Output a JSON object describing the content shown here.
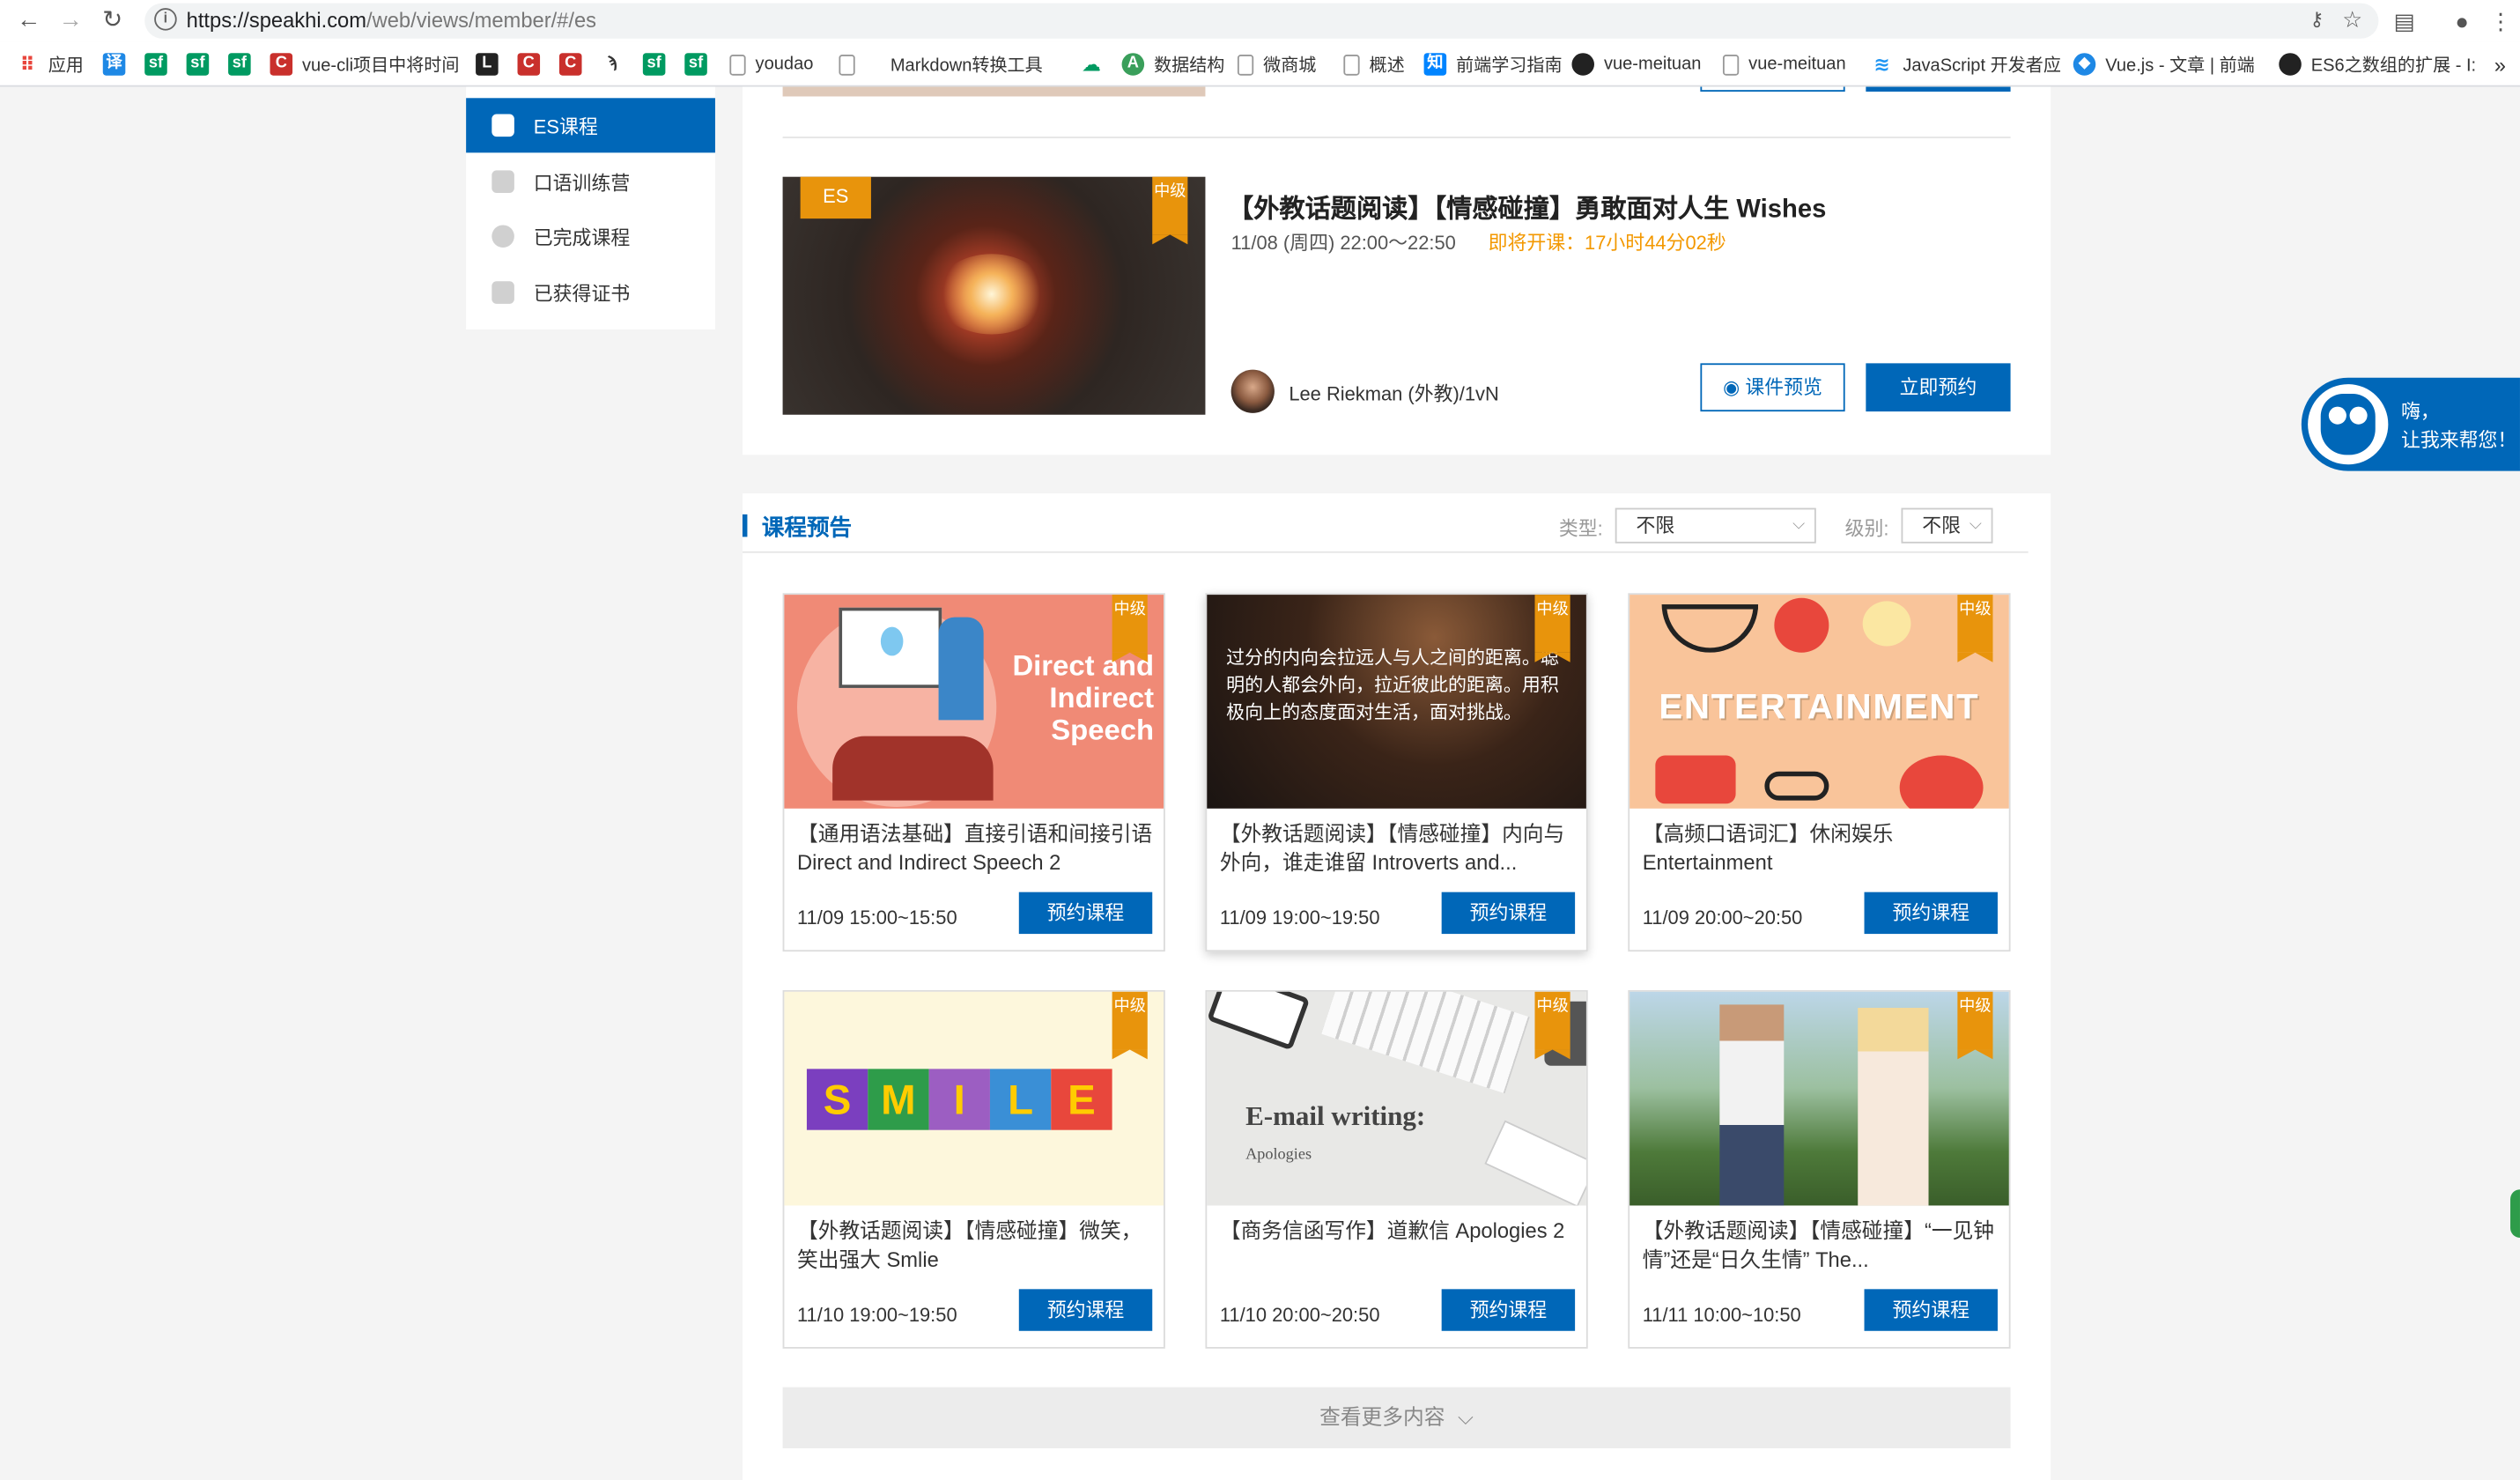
{
  "browser": {
    "url_host": "https://speakhi.com",
    "url_path": "/web/views/member/#/es",
    "bookmarks": [
      "应用",
      "vue-cli项目中将时间",
      "youdao",
      "Markdown转换工具",
      "数据结构",
      "微商城",
      "概述",
      "前端学习指南",
      "vue-meituan",
      "vue-meituan",
      "JavaScript 开发者应",
      "Vue.js - 文章 | 前端",
      "ES6之数组的扩展 - I:"
    ],
    "bookmark_icons": [
      "译",
      "sf",
      "sf",
      "sf",
      "C",
      "C",
      "C",
      "sf",
      "sf",
      "知"
    ]
  },
  "sidebar": {
    "items": [
      {
        "label": "ES课程",
        "active": true
      },
      {
        "label": "口语训练营",
        "active": false
      },
      {
        "label": "已完成课程",
        "active": false
      },
      {
        "label": "已获得证书",
        "active": false
      }
    ]
  },
  "featured": {
    "badge": "ES",
    "level": "中级",
    "title": "【外教话题阅读】【情感碰撞】勇敢面对人生 Wishes",
    "time": "11/08 (周四) 22:00～22:50",
    "countdown": "即将开课：17小时44分02秒",
    "teacher": "Lee Riekman (外教)/1vN",
    "preview_label": "课件预览",
    "book_label": "立即预约"
  },
  "preview_section": {
    "title": "课程预告",
    "type_label": "类型:",
    "type_value": "不限",
    "level_label": "级别:",
    "level_value": "不限",
    "more_label": "查看更多内容",
    "cards": [
      {
        "title": "【通用语法基础】直接引语和间接引语 Direct and Indirect Speech 2",
        "time": "11/09 15:00~15:50",
        "button": "预约课程",
        "level": "中级",
        "image_text": "Direct and Indirect Speech"
      },
      {
        "title": "【外教话题阅读】【情感碰撞】内向与外向，谁走谁留 Introverts and...",
        "time": "11/09 19:00~19:50",
        "button": "预约课程",
        "level": "中级",
        "image_text": "过分的内向会拉远人与人之间的距离。聪明的人都会外向，拉近彼此的距离。用积极向上的态度面对生活，面对挑战。"
      },
      {
        "title": "【高频口语词汇】休闲娱乐 Entertainment",
        "time": "11/09 20:00~20:50",
        "button": "预约课程",
        "level": "中级",
        "image_text": "ENTERTAINMENT"
      },
      {
        "title": "【外教话题阅读】【情感碰撞】微笑，笑出强大 Smlie",
        "time": "11/10 19:00~19:50",
        "button": "预约课程",
        "level": "中级",
        "image_text": "SMILE"
      },
      {
        "title": "【商务信函写作】道歉信 Apologies 2",
        "time": "11/10 20:00~20:50",
        "button": "预约课程",
        "level": "中级",
        "image_text": "E-mail writing:",
        "image_subtext": "Apologies"
      },
      {
        "title": "【外教话题阅读】【情感碰撞】“一见钟情”还是“日久生情” The...",
        "time": "11/11 10:00~10:50",
        "button": "预约课程",
        "level": "中级",
        "image_text": ""
      }
    ]
  },
  "help_widget": {
    "line1": "嗨，",
    "line2": "让我来帮您！"
  }
}
